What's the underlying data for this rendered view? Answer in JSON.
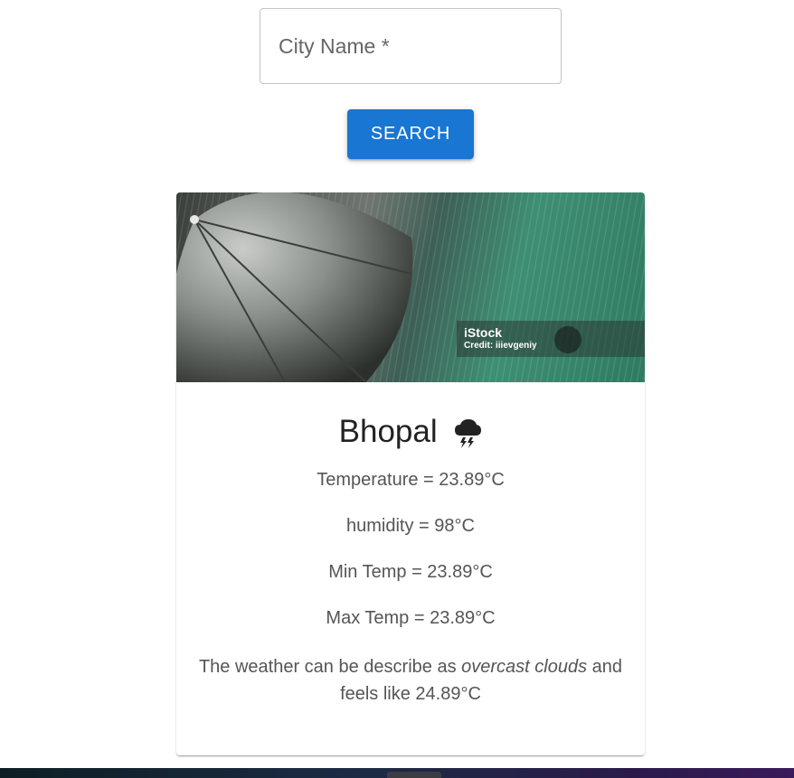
{
  "search": {
    "placeholder": "City Name *",
    "value": "",
    "button_label": "SEARCH"
  },
  "card": {
    "image": {
      "watermark_brand": "iStock",
      "watermark_credit": "Credit: iiievgeniy"
    },
    "city": "Bhopal",
    "weather_icon": "thunderstorm-cloud-icon",
    "temperature": "Temperature = 23.89°C",
    "humidity": "humidity = 98°C",
    "min_temp": "Min Temp = 23.89°C",
    "max_temp": "Max Temp = 23.89°C",
    "description_prefix": "The weather can be describe as ",
    "description_condition": "overcast clouds",
    "description_suffix": " and feels like 24.89°C"
  },
  "colors": {
    "button_primary": "#1976d2",
    "text_secondary": "#555555",
    "border": "#c4c4c4"
  }
}
